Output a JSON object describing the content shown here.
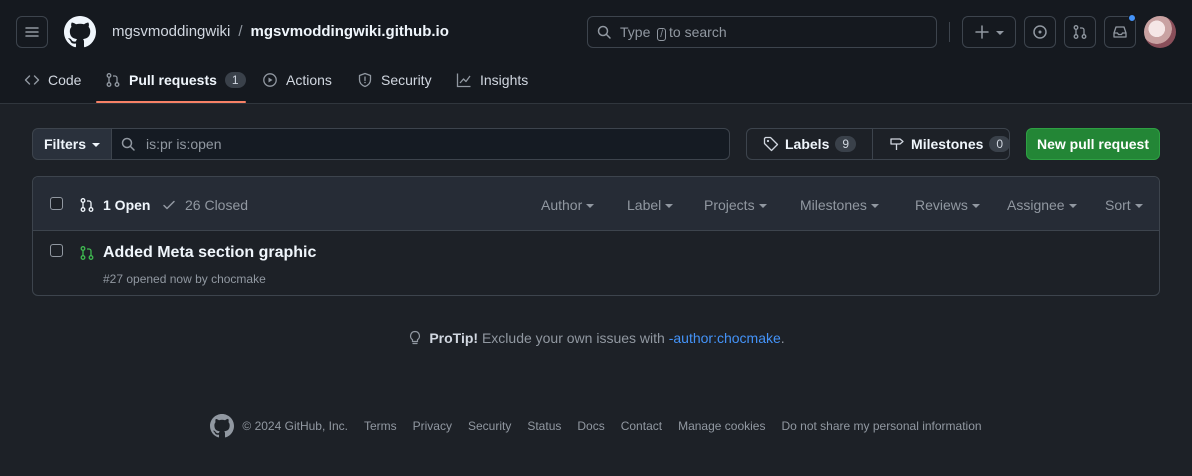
{
  "header": {
    "owner": "mgsvmoddingwiki",
    "separator": "/",
    "repo": "mgsvmoddingwiki.github.io",
    "search_prefix": "Type",
    "search_key": "/",
    "search_suffix": "to search",
    "add_label": "+"
  },
  "tabs": [
    {
      "label": "Code"
    },
    {
      "label": "Pull requests",
      "count": "1"
    },
    {
      "label": "Actions"
    },
    {
      "label": "Security"
    },
    {
      "label": "Insights"
    }
  ],
  "filterbar": {
    "filters_label": "Filters",
    "query": "is:pr is:open",
    "labels_label": "Labels",
    "labels_count": "9",
    "milestones_label": "Milestones",
    "milestones_count": "0",
    "new_pr_label": "New pull request"
  },
  "list": {
    "open_label": "1 Open",
    "closed_label": "26 Closed",
    "menus": [
      "Author",
      "Label",
      "Projects",
      "Milestones",
      "Reviews",
      "Assignee",
      "Sort"
    ],
    "items": [
      {
        "title": "Added Meta section graphic",
        "meta": "#27 opened now by chocmake"
      }
    ]
  },
  "protip": {
    "label": "ProTip!",
    "text": "Exclude your own issues with",
    "link": "-author:chocmake",
    "end": "."
  },
  "footer": {
    "copyright": "© 2024 GitHub, Inc.",
    "links": [
      "Terms",
      "Privacy",
      "Security",
      "Status",
      "Docs",
      "Contact",
      "Manage cookies",
      "Do not share my personal information"
    ]
  },
  "colors": {
    "accent_underline": "#f78166",
    "primary_button": "#238636",
    "link": "#4493f8",
    "open_pr": "#3fb950"
  }
}
